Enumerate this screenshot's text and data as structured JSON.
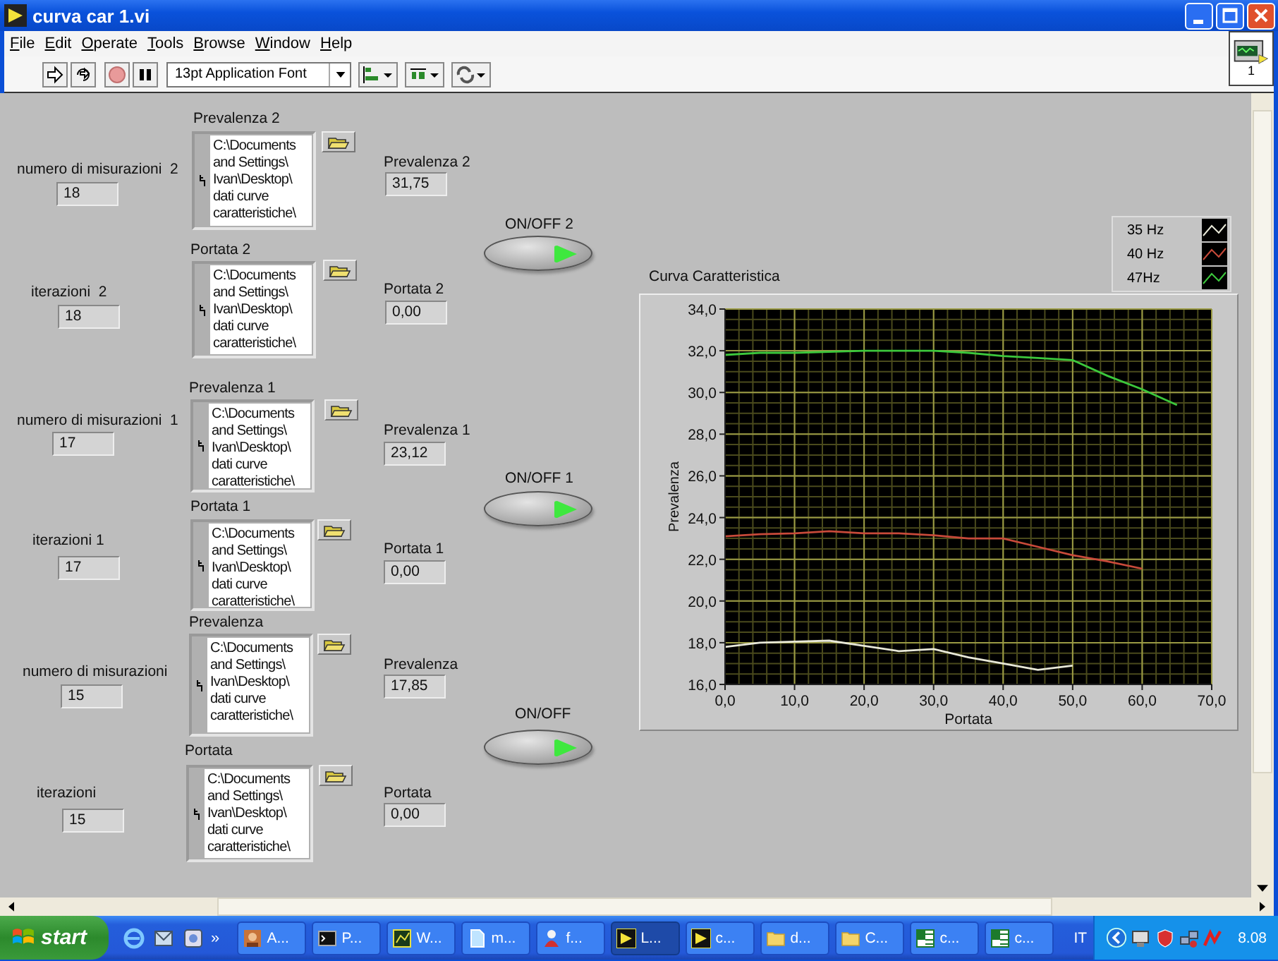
{
  "window": {
    "title": "curva car 1.vi"
  },
  "menu": [
    "File",
    "Edit",
    "Operate",
    "Tools",
    "Browse",
    "Window",
    "Help"
  ],
  "toolbar": {
    "font": "13pt Application Font",
    "vi_icon_label": "1"
  },
  "groups": [
    {
      "count": {
        "label": "numero di misurazioni  2",
        "value": "18"
      },
      "head_path": {
        "label": "Prevalenza 2",
        "lines": [
          "C:\\Documents",
          "and Settings\\",
          "Ivan\\Desktop\\",
          "dati curve",
          "caratteristiche\\"
        ]
      },
      "head": {
        "label": "Prevalenza 2",
        "value": "31,75"
      },
      "iter": {
        "label": "iterazioni  2",
        "value": "18"
      },
      "flow_path": {
        "label": "Portata 2",
        "lines": [
          "C:\\Documents",
          "and Settings\\",
          "Ivan\\Desktop\\",
          "dati curve",
          "caratteristiche\\"
        ]
      },
      "flow": {
        "label": "Portata 2",
        "value": "0,00"
      },
      "switch": {
        "label": "ON/OFF 2",
        "on": true
      }
    },
    {
      "count": {
        "label": "numero di misurazioni  1",
        "value": "17"
      },
      "head_path": {
        "label": "Prevalenza 1",
        "lines": [
          "C:\\Documents",
          "and Settings\\",
          "Ivan\\Desktop\\",
          "dati curve",
          "caratteristiche\\"
        ]
      },
      "head": {
        "label": "Prevalenza 1",
        "value": "23,12"
      },
      "iter": {
        "label": "iterazioni 1",
        "value": "17"
      },
      "flow_path": {
        "label": "Portata 1",
        "lines": [
          "C:\\Documents",
          "and Settings\\",
          "Ivan\\Desktop\\",
          "dati curve",
          "caratteristiche\\"
        ]
      },
      "flow": {
        "label": "Portata 1",
        "value": "0,00"
      },
      "switch": {
        "label": "ON/OFF 1",
        "on": true
      }
    },
    {
      "count": {
        "label": "numero di misurazioni",
        "value": "15"
      },
      "head_path": {
        "label": "Prevalenza",
        "lines": [
          "C:\\Documents",
          "and Settings\\",
          "Ivan\\Desktop\\",
          "dati curve",
          "caratteristiche\\"
        ]
      },
      "head": {
        "label": "Prevalenza",
        "value": "17,85"
      },
      "iter": {
        "label": "iterazioni",
        "value": "15"
      },
      "flow_path": {
        "label": "Portata",
        "lines": [
          "C:\\Documents",
          "and Settings\\",
          "Ivan\\Desktop\\",
          "dati curve",
          "caratteristiche\\"
        ]
      },
      "flow": {
        "label": "Portata",
        "value": "0,00"
      },
      "switch": {
        "label": "ON/OFF",
        "on": true
      }
    }
  ],
  "chart": {
    "chart_data": {
      "type": "line",
      "title": "Curva Caratteristica",
      "xlabel": "Portata",
      "ylabel": "Prevalenza",
      "x": [
        0,
        5,
        10,
        15,
        20,
        25,
        30,
        35,
        40,
        45,
        50,
        55,
        60,
        65
      ],
      "grid": true,
      "series": [
        {
          "name": "35 Hz",
          "color": "#e8e8d8",
          "values": [
            17.8,
            18.0,
            18.05,
            18.1,
            17.85,
            17.6,
            17.7,
            17.3,
            17.0,
            16.7,
            16.9,
            null,
            null,
            null
          ]
        },
        {
          "name": "40 Hz",
          "color": "#c84a3a",
          "values": [
            23.1,
            23.2,
            23.25,
            23.35,
            23.25,
            23.25,
            23.15,
            23.0,
            23.0,
            22.6,
            22.2,
            21.9,
            21.55,
            null
          ]
        },
        {
          "name": "47Hz",
          "color": "#3cc83c",
          "values": [
            31.8,
            31.9,
            31.9,
            31.95,
            32.0,
            32.0,
            32.0,
            31.9,
            31.75,
            31.65,
            31.55,
            30.8,
            30.15,
            29.4
          ]
        }
      ],
      "xlim": [
        0,
        70
      ],
      "ylim": [
        16,
        34
      ],
      "xticks": [
        {
          "value": 0,
          "label": "0,0"
        },
        {
          "value": 10,
          "label": "10,0"
        },
        {
          "value": 20,
          "label": "20,0"
        },
        {
          "value": 30,
          "label": "30,0"
        },
        {
          "value": 40,
          "label": "40,0"
        },
        {
          "value": 50,
          "label": "50,0"
        },
        {
          "value": 60,
          "label": "60,0"
        },
        {
          "value": 70,
          "label": "70,0"
        }
      ],
      "yticks": [
        {
          "value": 16,
          "label": "16,0"
        },
        {
          "value": 18,
          "label": "18,0"
        },
        {
          "value": 20,
          "label": "20,0"
        },
        {
          "value": 22,
          "label": "22,0"
        },
        {
          "value": 24,
          "label": "24,0"
        },
        {
          "value": 26,
          "label": "26,0"
        },
        {
          "value": 28,
          "label": "28,0"
        },
        {
          "value": 30,
          "label": "30,0"
        },
        {
          "value": 32,
          "label": "32,0"
        },
        {
          "value": 34,
          "label": "34,0"
        }
      ]
    }
  },
  "taskbar": {
    "start": "start",
    "more": "»",
    "tasks": [
      {
        "kind": "image",
        "label": "A...",
        "selected": false
      },
      {
        "kind": "console",
        "label": "P...",
        "selected": false
      },
      {
        "kind": "grid",
        "label": "W...",
        "selected": false
      },
      {
        "kind": "doc",
        "label": "m...",
        "selected": false
      },
      {
        "kind": "figure",
        "label": "f...",
        "selected": false
      },
      {
        "kind": "labview",
        "label": "L...",
        "selected": true
      },
      {
        "kind": "labview",
        "label": "c...",
        "selected": false
      },
      {
        "kind": "folder",
        "label": "d...",
        "selected": false
      },
      {
        "kind": "folder",
        "label": "C...",
        "selected": false
      },
      {
        "kind": "sheet",
        "label": "c...",
        "selected": false
      },
      {
        "kind": "sheet",
        "label": "c...",
        "selected": false
      }
    ],
    "language": "IT",
    "time": "8.08"
  }
}
